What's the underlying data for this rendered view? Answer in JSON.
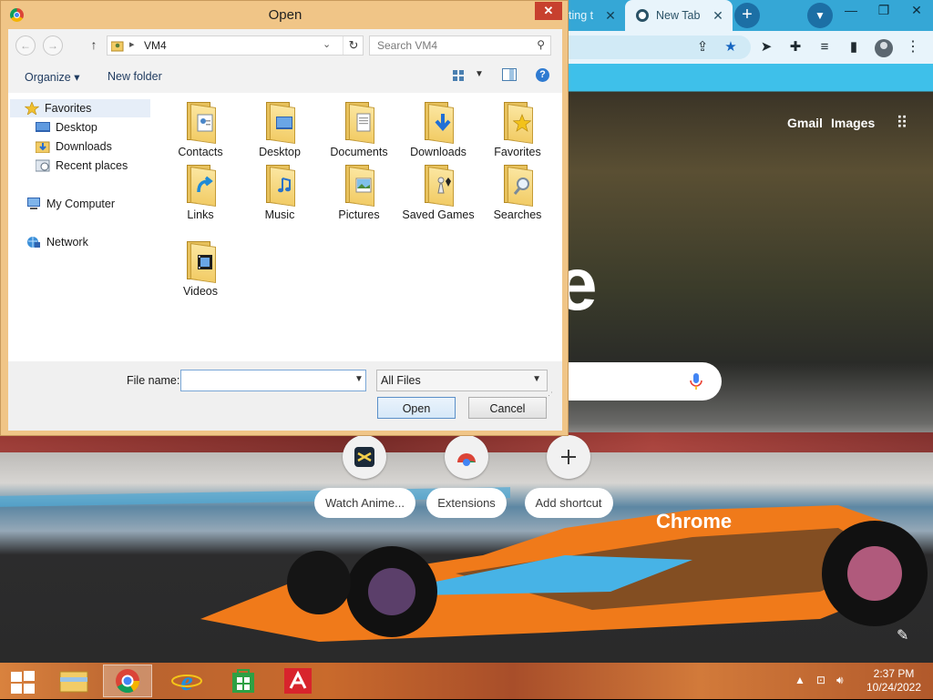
{
  "browser": {
    "tabs": [
      {
        "title": "ting t"
      },
      {
        "title": "New Tab"
      }
    ],
    "ntp": {
      "top_links": [
        "Gmail",
        "Images"
      ],
      "logo_fragment": "e",
      "shortcuts": [
        {
          "label": "Watch Anime..."
        },
        {
          "label": "Extensions"
        },
        {
          "label": "Add shortcut"
        }
      ],
      "car_text": "Chrome"
    }
  },
  "dialog": {
    "title": "Open",
    "address": {
      "path": "VM4"
    },
    "search": {
      "placeholder": "Search VM4"
    },
    "commands": {
      "organize": "Organize",
      "new_folder": "New folder"
    },
    "nav": [
      {
        "label": "Favorites",
        "icon": "star-icon"
      },
      {
        "label": "Desktop",
        "icon": "desktop-icon"
      },
      {
        "label": "Downloads",
        "icon": "downloads-folder-icon"
      },
      {
        "label": "Recent places",
        "icon": "recent-places-icon"
      },
      {
        "label": "My Computer",
        "icon": "computer-icon"
      },
      {
        "label": "Network",
        "icon": "network-icon"
      }
    ],
    "files": [
      {
        "label": "Contacts",
        "icon": "contacts-folder-icon"
      },
      {
        "label": "Desktop",
        "icon": "desktop-folder-icon"
      },
      {
        "label": "Documents",
        "icon": "documents-folder-icon"
      },
      {
        "label": "Downloads",
        "icon": "downloads-folder-icon"
      },
      {
        "label": "Favorites",
        "icon": "favorites-folder-icon"
      },
      {
        "label": "Links",
        "icon": "links-folder-icon"
      },
      {
        "label": "Music",
        "icon": "music-folder-icon"
      },
      {
        "label": "Pictures",
        "icon": "pictures-folder-icon"
      },
      {
        "label": "Saved Games",
        "icon": "saved-games-folder-icon"
      },
      {
        "label": "Searches",
        "icon": "searches-folder-icon"
      },
      {
        "label": "Videos",
        "icon": "videos-folder-icon"
      }
    ],
    "file_name": {
      "label": "File name:",
      "value": ""
    },
    "file_type": {
      "selected": "All Files"
    },
    "buttons": {
      "open": "Open",
      "cancel": "Cancel"
    }
  },
  "taskbar": {
    "apps": [
      "file-explorer",
      "chrome",
      "internet-explorer",
      "store",
      "avira"
    ],
    "clock": {
      "time": "2:37 PM",
      "date": "10/24/2022"
    }
  },
  "colors": {
    "dialog_frame": "#f0c587",
    "close_button": "#c7402e",
    "tab_strip": "#35a7d6",
    "toolbar": "#e8f4fb",
    "taskbar": "#c96a2c"
  }
}
